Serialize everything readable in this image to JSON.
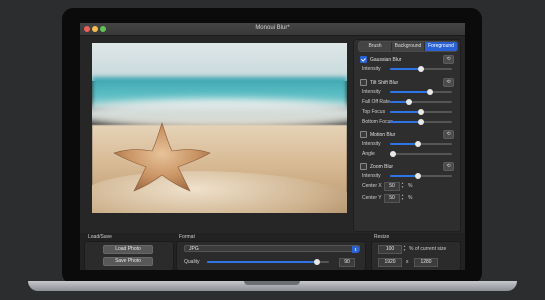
{
  "window": {
    "title": "Monoui Blur*"
  },
  "tabs": [
    {
      "label": "Brush"
    },
    {
      "label": "Background"
    },
    {
      "label": "Foreground",
      "active": true
    }
  ],
  "gaussian": {
    "label": "Gaussian Blur",
    "checked": true,
    "intensity_label": "Intensity",
    "intensity": 0.5
  },
  "tiltshift": {
    "label": "Tilt Shift Blur",
    "checked": false,
    "intensity_label": "Intensity",
    "intensity": 0.65,
    "falloff_label": "Fall Off Rate",
    "falloff": 0.3,
    "topfocus_label": "Top Focus",
    "topfocus": 0.5,
    "bottomfocus_label": "Bottom Focus",
    "bottomfocus": 0.5
  },
  "motion": {
    "label": "Motion Blur",
    "checked": false,
    "intensity_label": "Intensity",
    "intensity": 0.45,
    "angle_label": "Angle",
    "angle": 0.05
  },
  "zoom": {
    "label": "Zoom Blur",
    "checked": false,
    "intensity_label": "Intensity",
    "intensity": 0.45,
    "center_x_label": "Center X",
    "center_x": "50",
    "center_y_label": "Center Y",
    "center_y": "50",
    "unit": "%"
  },
  "load_save": {
    "label": "Load/Save",
    "load_button": "Load Photo",
    "save_button": "Save Photo"
  },
  "format": {
    "label": "Format",
    "selected": "JPG",
    "quality_label": "Quality",
    "quality": 90,
    "quality_text": "90"
  },
  "resize": {
    "label": "Resize",
    "percent": "100",
    "percent_label": "% of current size",
    "width": "1920",
    "separator": "x",
    "height": "1280"
  },
  "icons": {
    "reset": "reset-icon",
    "chevron": "chevron-updown-icon"
  },
  "colors": {
    "accent": "#2a62d4",
    "slider": "#2f74e6"
  }
}
